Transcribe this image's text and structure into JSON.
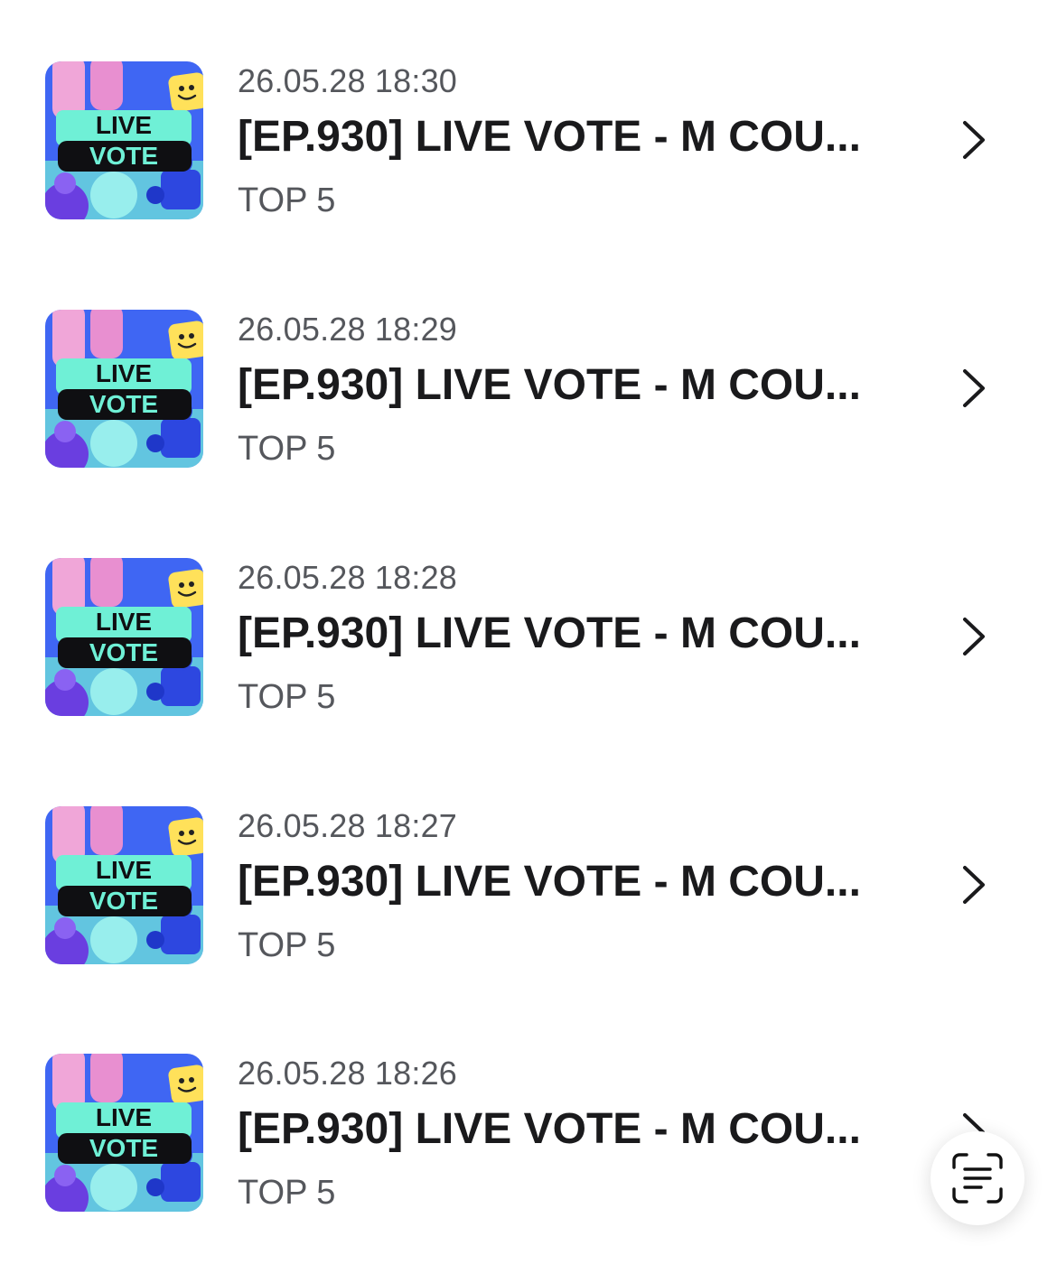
{
  "items": [
    {
      "date": "26.05.28 18:30",
      "title": "[EP.930] LIVE VOTE - M COU...",
      "subtitle": "TOP 5"
    },
    {
      "date": "26.05.28 18:29",
      "title": "[EP.930] LIVE VOTE - M COU...",
      "subtitle": "TOP 5"
    },
    {
      "date": "26.05.28 18:28",
      "title": "[EP.930] LIVE VOTE - M COU...",
      "subtitle": "TOP 5"
    },
    {
      "date": "26.05.28 18:27",
      "title": "[EP.930] LIVE VOTE - M COU...",
      "subtitle": "TOP 5"
    },
    {
      "date": "26.05.28 18:26",
      "title": "[EP.930] LIVE VOTE - M COU...",
      "subtitle": "TOP 5"
    }
  ],
  "thumbnail": {
    "line1": "LIVE",
    "line2": "VOTE"
  },
  "icons": {
    "row_chevron": "chevron-right-icon",
    "scan_button": "text-scan-icon"
  },
  "colors": {
    "title": "#1a1a1c",
    "meta": "#55575c",
    "thumb_blue": "#3a5cf0",
    "thumb_mint": "#6ff0d6",
    "thumb_black": "#0f0f12"
  }
}
